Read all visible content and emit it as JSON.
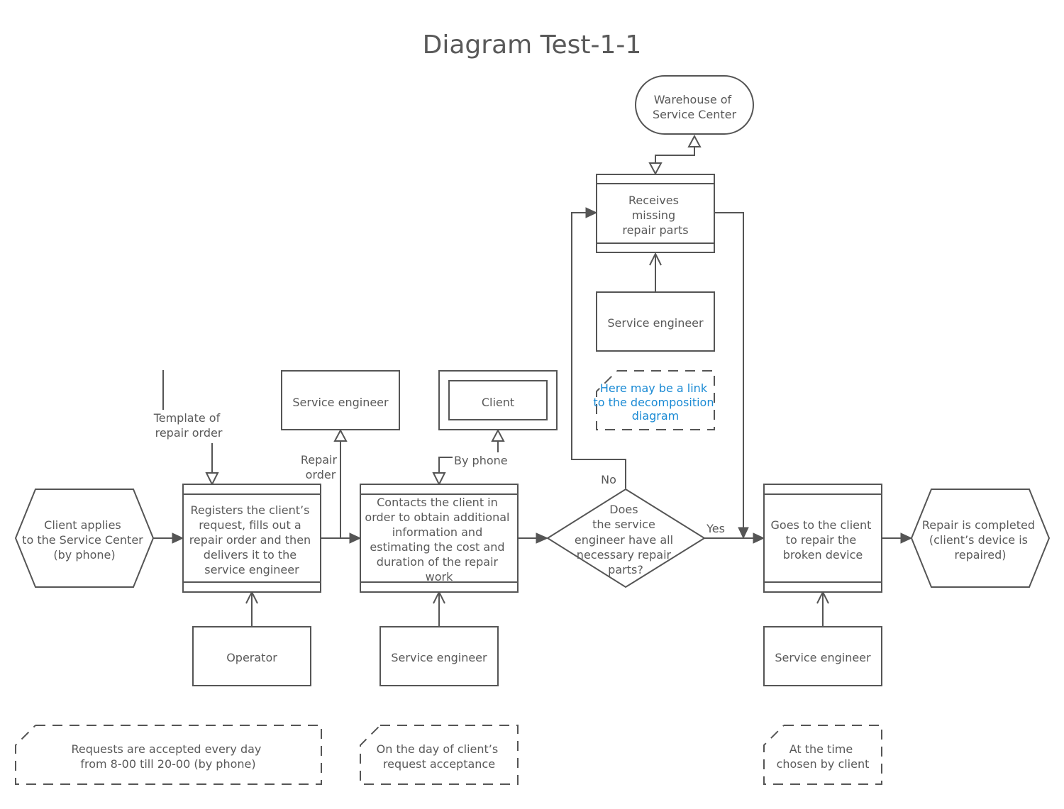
{
  "title": "Diagram Test-1-1",
  "nodes": {
    "warehouse": {
      "label": [
        "Warehouse of",
        "Service Center"
      ]
    },
    "receives_parts": {
      "label": [
        "Receives",
        "missing",
        "repair parts"
      ]
    },
    "engineer_top": {
      "label": [
        "Service engineer"
      ]
    },
    "decomposition_note": {
      "label": [
        "Here may be a link",
        "to the decomposition",
        "diagram"
      ],
      "color": "#1a8ad4"
    },
    "template_label": {
      "label": [
        "Template of",
        "repair order"
      ]
    },
    "engineer_repair": {
      "label": [
        "Service engineer"
      ]
    },
    "repair_order_label": {
      "label": [
        "Repair",
        "order"
      ]
    },
    "client": {
      "label": [
        "Client"
      ]
    },
    "by_phone_label": {
      "label": [
        "By phone"
      ]
    },
    "client_applies": {
      "label": [
        "Client applies",
        "to the Service Center",
        "(by phone)"
      ]
    },
    "registers": {
      "label": [
        "Registers the client’s",
        "request, fills out a",
        "repair order and then",
        "delivers it to the",
        "service engineer"
      ]
    },
    "contacts": {
      "label": [
        "Contacts the client in",
        "order to obtain additional",
        "information and",
        "estimating the cost and",
        "duration of the repair",
        "work"
      ]
    },
    "decision": {
      "label": [
        "Does",
        "the service",
        "engineer have all",
        "necessary repair",
        "parts?"
      ]
    },
    "no_label": {
      "label": [
        "No"
      ]
    },
    "yes_label": {
      "label": [
        "Yes"
      ]
    },
    "goes_to_client": {
      "label": [
        "Goes to the client",
        "to repair the",
        "broken device"
      ]
    },
    "repair_completed": {
      "label": [
        "Repair is completed",
        "(client’s device is",
        "repaired)"
      ]
    },
    "operator": {
      "label": [
        "Operator"
      ]
    },
    "engineer_contacts": {
      "label": [
        "Service engineer"
      ]
    },
    "engineer_goes": {
      "label": [
        "Service engineer"
      ]
    },
    "note_requests": {
      "label": [
        "Requests are accepted every day",
        "from 8-00 till 20-00 (by phone)"
      ]
    },
    "note_day": {
      "label": [
        "On the day of client’s",
        "request acceptance"
      ]
    },
    "note_time": {
      "label": [
        "At the time",
        "chosen by client"
      ]
    }
  }
}
